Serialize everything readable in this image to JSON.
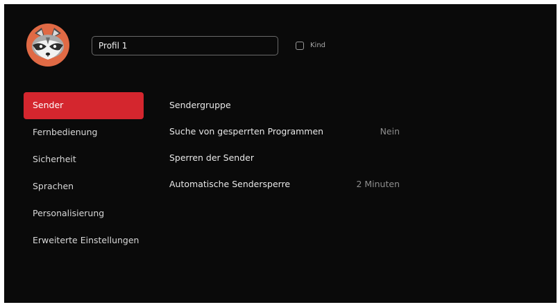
{
  "profile": {
    "name_value": "Profil 1",
    "kind_label": "Kind",
    "kind_checked": false,
    "avatar_icon": "raccoon-icon",
    "avatar_color": "#e06a45"
  },
  "sidebar": {
    "items": [
      {
        "label": "Sender",
        "active": true
      },
      {
        "label": "Fernbedienung",
        "active": false
      },
      {
        "label": "Sicherheit",
        "active": false
      },
      {
        "label": "Sprachen",
        "active": false
      },
      {
        "label": "Personalisierung",
        "active": false
      },
      {
        "label": "Erweiterte Einstellungen",
        "active": false
      }
    ],
    "accent_color": "#d4262e"
  },
  "settings": {
    "rows": [
      {
        "label": "Sendergruppe",
        "value": ""
      },
      {
        "label": "Suche von gesperrten Programmen",
        "value": "Nein"
      },
      {
        "label": "Sperren der Sender",
        "value": ""
      },
      {
        "label": "Automatische Sendersperre",
        "value": "2 Minuten"
      }
    ]
  },
  "theme": {
    "background": "#0a0a0a",
    "text": "#e8e8e8",
    "muted": "#8e8e8e"
  }
}
